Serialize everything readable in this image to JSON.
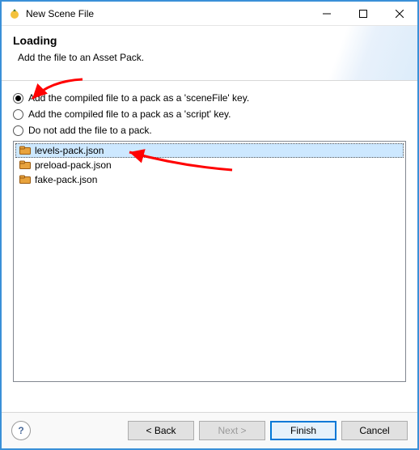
{
  "window": {
    "title": "New Scene File"
  },
  "header": {
    "heading": "Loading",
    "subtitle": "Add the file to an Asset Pack."
  },
  "options": {
    "opt1": "Add the compiled file to a pack as a 'sceneFile' key.",
    "opt2": "Add the compiled file to a pack as a 'script' key.",
    "opt3": "Do not add the file to a pack."
  },
  "files": {
    "f0": "levels-pack.json",
    "f1": "preload-pack.json",
    "f2": "fake-pack.json"
  },
  "buttons": {
    "back": "< Back",
    "next": "Next >",
    "finish": "Finish",
    "cancel": "Cancel"
  },
  "help_char": "?"
}
